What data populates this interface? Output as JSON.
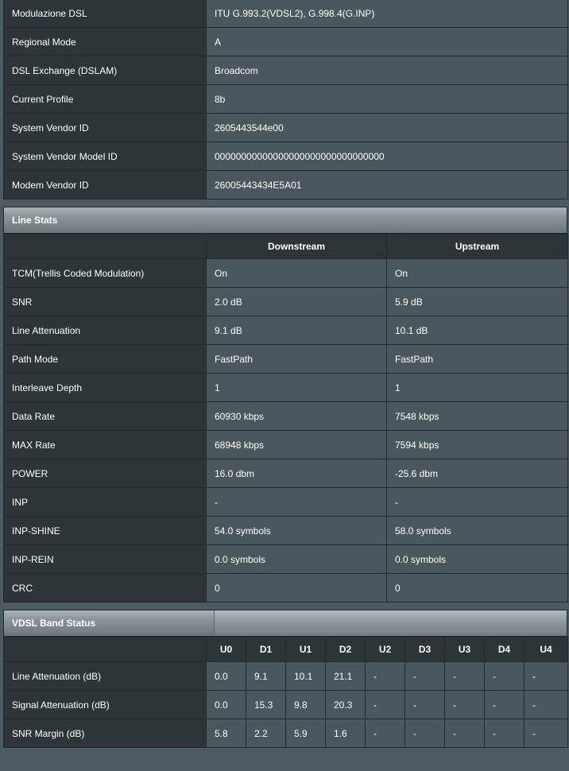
{
  "info_rows": [
    {
      "label": "Modulazione DSL",
      "value": "ITU G.993.2(VDSL2), G.998.4(G.INP)"
    },
    {
      "label": "Regional Mode",
      "value": "A"
    },
    {
      "label": "DSL Exchange (DSLAM)",
      "value": "Broadcom"
    },
    {
      "label": "Current Profile",
      "value": "8b"
    },
    {
      "label": "System Vendor ID",
      "value": "2605443544e00"
    },
    {
      "label": "System Vendor Model ID",
      "value": "00000000000000000000000000000000"
    },
    {
      "label": "Modem Vendor ID",
      "value": "26005443434E5A01"
    }
  ],
  "line_stats": {
    "title": "Line Stats",
    "col_downstream": "Downstream",
    "col_upstream": "Upstream",
    "rows": [
      {
        "label": "TCM(Trellis Coded Modulation)",
        "down": "On",
        "up": "On"
      },
      {
        "label": "SNR",
        "down": "2.0 dB",
        "up": "5.9 dB"
      },
      {
        "label": "Line Attenuation",
        "down": "9.1 dB",
        "up": "10.1 dB"
      },
      {
        "label": "Path Mode",
        "down": "FastPath",
        "up": "FastPath"
      },
      {
        "label": "Interleave Depth",
        "down": "1",
        "up": "1"
      },
      {
        "label": "Data Rate",
        "down": "60930 kbps",
        "up": "7548 kbps"
      },
      {
        "label": "MAX Rate",
        "down": "68948 kbps",
        "up": "7594 kbps"
      },
      {
        "label": "POWER",
        "down": "16.0 dbm",
        "up": "-25.6 dbm"
      },
      {
        "label": "INP",
        "down": "-",
        "up": "-"
      },
      {
        "label": "INP-SHINE",
        "down": "54.0 symbols",
        "up": "58.0 symbols"
      },
      {
        "label": "INP-REIN",
        "down": "0.0 symbols",
        "up": "0.0 symbols"
      },
      {
        "label": "CRC",
        "down": "0",
        "up": "0"
      }
    ]
  },
  "vdsl_band": {
    "title": "VDSL Band Status",
    "columns": [
      "U0",
      "D1",
      "U1",
      "D2",
      "U2",
      "D3",
      "U3",
      "D4",
      "U4"
    ],
    "rows": [
      {
        "label": "Line Attenuation (dB)",
        "values": [
          "0.0",
          "9.1",
          "10.1",
          "21.1",
          "-",
          "-",
          "-",
          "-",
          "-"
        ]
      },
      {
        "label": "Signal Attenuation (dB)",
        "values": [
          "0.0",
          "15.3",
          "9.8",
          "20.3",
          "-",
          "-",
          "-",
          "-",
          "-"
        ]
      },
      {
        "label": "SNR Margin (dB)",
        "values": [
          "5.8",
          "2.2",
          "5.9",
          "1.6",
          "-",
          "-",
          "-",
          "-",
          "-"
        ]
      }
    ]
  },
  "colors": {
    "upstream": "#3fb4ef",
    "downstream": "#f39c2e"
  }
}
